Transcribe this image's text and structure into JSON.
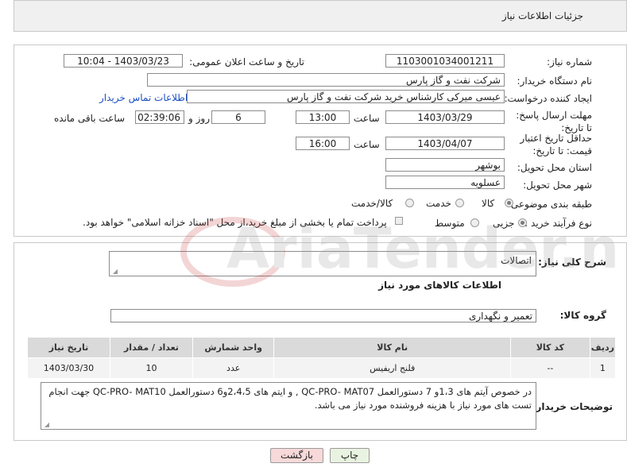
{
  "header": {
    "title": "جزئیات اطلاعات نیاز"
  },
  "fields": {
    "need_number_label": "شماره نیاز:",
    "need_number": "1103001034001211",
    "announce_label": "تاریخ و ساعت اعلان عمومی:",
    "announce_value": "1403/03/23 - 10:04",
    "buyer_org_label": "نام دستگاه خریدار:",
    "buyer_org": "شرکت نفت و گاز پارس",
    "creator_label": "ایجاد کننده درخواست:",
    "creator": "عیسی میرکی کارشناس خرید شرکت نفت و گاز پارس",
    "contact_link": "اطلاعات تماس خریدار",
    "deadline_label": "مهلت ارسال پاسخ: تا تاریخ:",
    "deadline_date": "1403/03/29",
    "time_word": "ساعت",
    "deadline_time": "13:00",
    "days_value": "6",
    "days_and": "روز و",
    "remaining_time": "02:39:06",
    "remaining_label": "ساعت باقی مانده",
    "min_price_label": "حداقل تاریخ اعتبار قیمت: تا تاریخ:",
    "min_price_date": "1403/04/07",
    "min_price_time": "16:00",
    "province_label": "استان محل تحویل:",
    "province": "بوشهر",
    "city_label": "شهر محل تحویل:",
    "city": "عسلویه",
    "category_label": "طبقه بندی موضوعی:",
    "category_options": [
      "کالا",
      "خدمت",
      "کالا/خدمت"
    ],
    "purchase_type_label": "نوع فرآیند خرید :",
    "purchase_options": [
      "جزیی",
      "متوسط"
    ],
    "payment_note": "پرداخت تمام یا بخشی از مبلغ خرید،از محل \"اسناد خزانه اسلامی\" خواهد بود."
  },
  "details": {
    "general_desc_label": "شرح کلی نیاز:",
    "general_desc": "اتصالات",
    "goods_info_title": "اطلاعات کالاهای مورد نیاز",
    "goods_group_label": "گروه کالا:",
    "goods_group": "تعمیر و نگهداری",
    "table": {
      "headers": [
        "ردیف",
        "کد کالا",
        "نام کالا",
        "واحد شمارش",
        "تعداد / مقدار",
        "تاریخ نیاز"
      ],
      "rows": [
        [
          "1",
          "--",
          "فلنج اریفیس",
          "عدد",
          "10",
          "1403/03/30"
        ]
      ]
    },
    "buyer_notes_label": "توضیحات خریدار:",
    "buyer_notes_line1": "در خصوص آیتم های 1،3و 7 دستورالعمل QC-PRO- MAT07 , و ایتم های 2،4،5و6 دستورالعمل  QC-PRO- MAT10 جهت انجام",
    "buyer_notes_line2": "تست های مورد نیاز با هزینه فروشنده مورد نیاز می باشد."
  },
  "buttons": {
    "print": "چاپ",
    "back": "بازگشت"
  },
  "watermark_text": "AriaTender.net",
  "colors": {
    "link": "#1a4ec4",
    "back_button_bg": "#f7d9d9",
    "print_button_bg": "#e9f3e1",
    "header_bg": "#dadada"
  }
}
